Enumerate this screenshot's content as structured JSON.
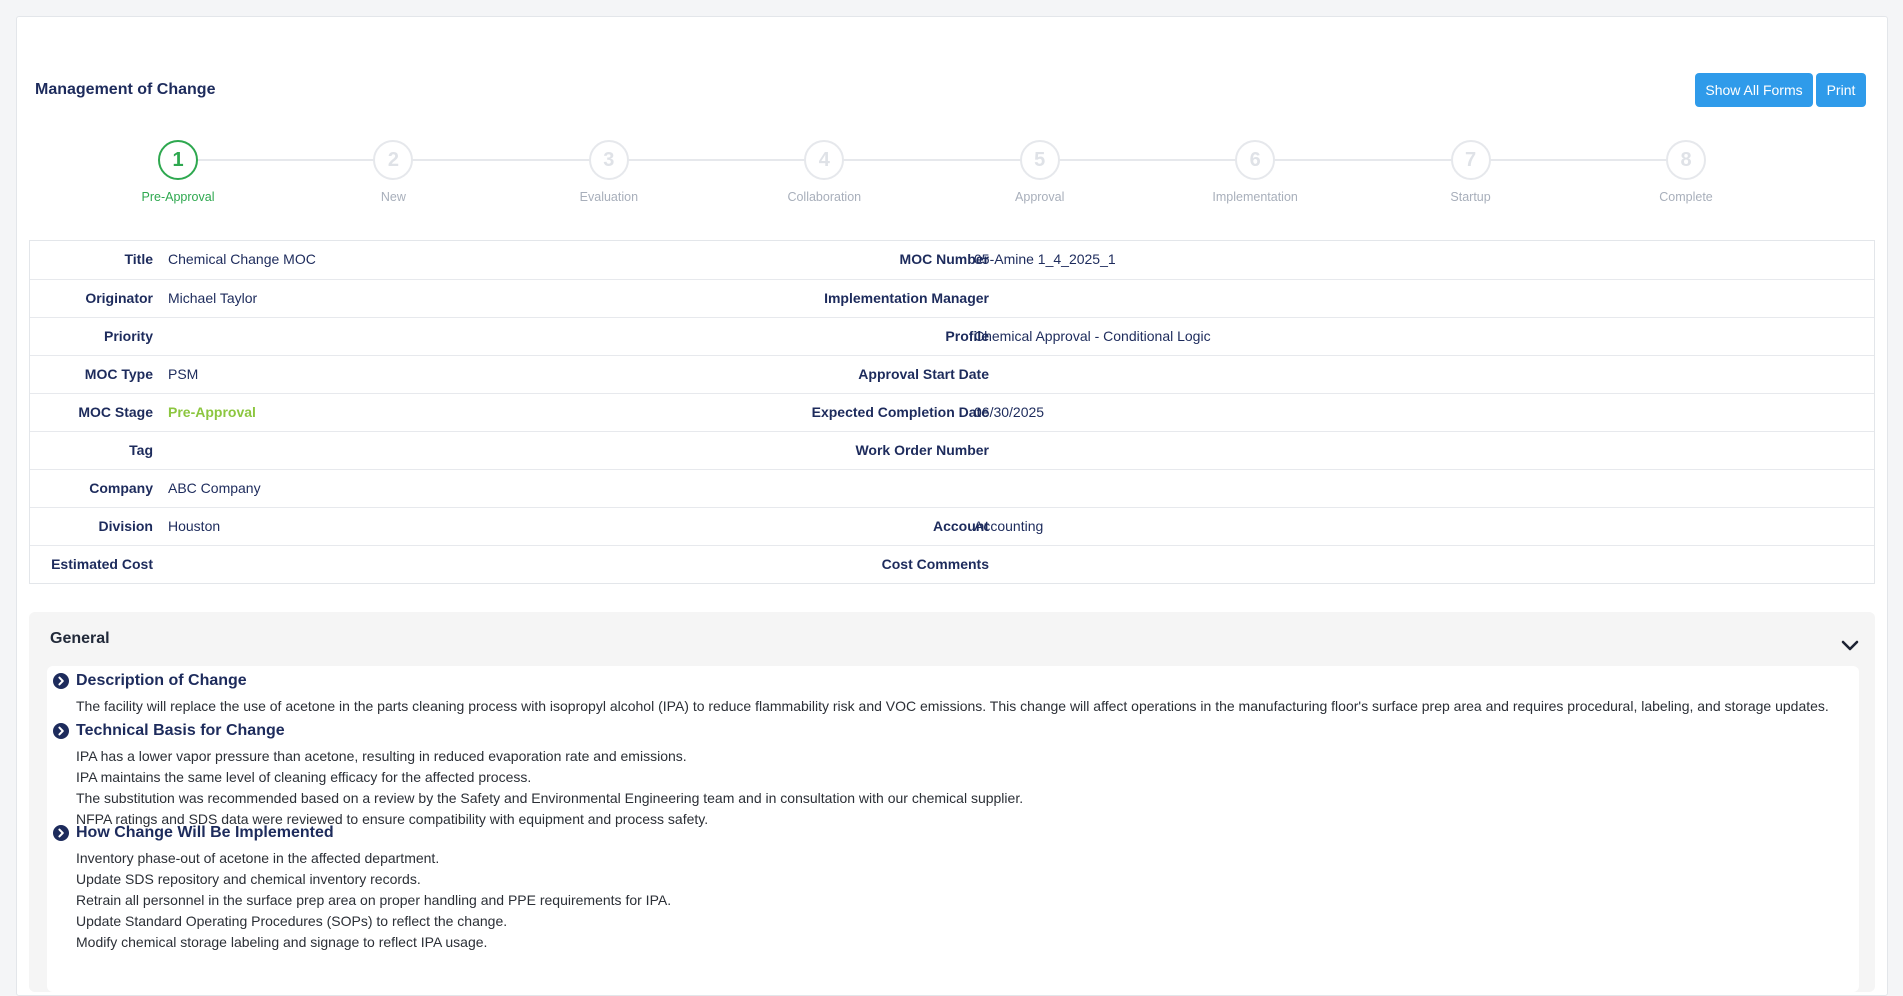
{
  "header": {
    "title": "Management of Change",
    "show_all_forms": "Show All Forms",
    "print": "Print"
  },
  "steps": [
    {
      "num": "1",
      "label": "Pre-Approval",
      "active": true
    },
    {
      "num": "2",
      "label": "New",
      "active": false
    },
    {
      "num": "3",
      "label": "Evaluation",
      "active": false
    },
    {
      "num": "4",
      "label": "Collaboration",
      "active": false
    },
    {
      "num": "5",
      "label": "Approval",
      "active": false
    },
    {
      "num": "6",
      "label": "Implementation",
      "active": false
    },
    {
      "num": "7",
      "label": "Startup",
      "active": false
    },
    {
      "num": "8",
      "label": "Complete",
      "active": false
    }
  ],
  "details": {
    "left": [
      {
        "label": "Title",
        "value": "Chemical Change MOC"
      },
      {
        "label": "Originator",
        "value": "Michael Taylor"
      },
      {
        "label": "Priority",
        "value": ""
      },
      {
        "label": "MOC Type",
        "value": "PSM"
      },
      {
        "label": "MOC Stage",
        "value": "Pre-Approval"
      },
      {
        "label": "Tag",
        "value": ""
      },
      {
        "label": "Company",
        "value": "ABC Company"
      },
      {
        "label": "Division",
        "value": "Houston"
      },
      {
        "label": "Estimated Cost",
        "value": ""
      }
    ],
    "right": [
      {
        "label": "MOC Number",
        "value": "05-Amine 1_4_2025_1"
      },
      {
        "label": "Implementation Manager",
        "value": ""
      },
      {
        "label": "Profile",
        "value": "Chemical Approval - Conditional Logic"
      },
      {
        "label": "Approval Start Date",
        "value": ""
      },
      {
        "label": "Expected Completion Date",
        "value": "06/30/2025"
      },
      {
        "label": "Work Order Number",
        "value": ""
      },
      {
        "label": "",
        "value": ""
      },
      {
        "label": "Account",
        "value": "Accounting"
      },
      {
        "label": "Cost Comments",
        "value": ""
      }
    ]
  },
  "colors": {
    "accent": "#2f9bea",
    "active_step": "#2ea84f",
    "stage_value": "#8cc63f"
  },
  "general": {
    "title": "General",
    "sections": [
      {
        "title": "Description of Change",
        "lines": [
          "The facility will replace the use of acetone in the parts cleaning process with isopropyl alcohol (IPA) to reduce flammability risk and VOC emissions. This change will affect operations in the manufacturing floor's surface prep area and requires procedural, labeling, and storage updates."
        ]
      },
      {
        "title": "Technical Basis for Change",
        "lines": [
          "IPA has a lower vapor pressure than acetone, resulting in reduced evaporation rate and emissions.",
          "IPA maintains the same level of cleaning efficacy for the affected process.",
          "The substitution was recommended based on a review by the Safety and Environmental Engineering team and in consultation with our chemical supplier.",
          "NFPA ratings and SDS data were reviewed to ensure compatibility with equipment and process safety."
        ]
      },
      {
        "title": "How Change Will Be Implemented",
        "lines": [
          "Inventory phase-out of acetone in the affected department.",
          "Update SDS repository and chemical inventory records.",
          "Retrain all personnel in the surface prep area on proper handling and PPE requirements for IPA.",
          "Update Standard Operating Procedures (SOPs) to reflect the change.",
          "Modify chemical storage labeling and signage to reflect IPA usage."
        ]
      }
    ]
  }
}
